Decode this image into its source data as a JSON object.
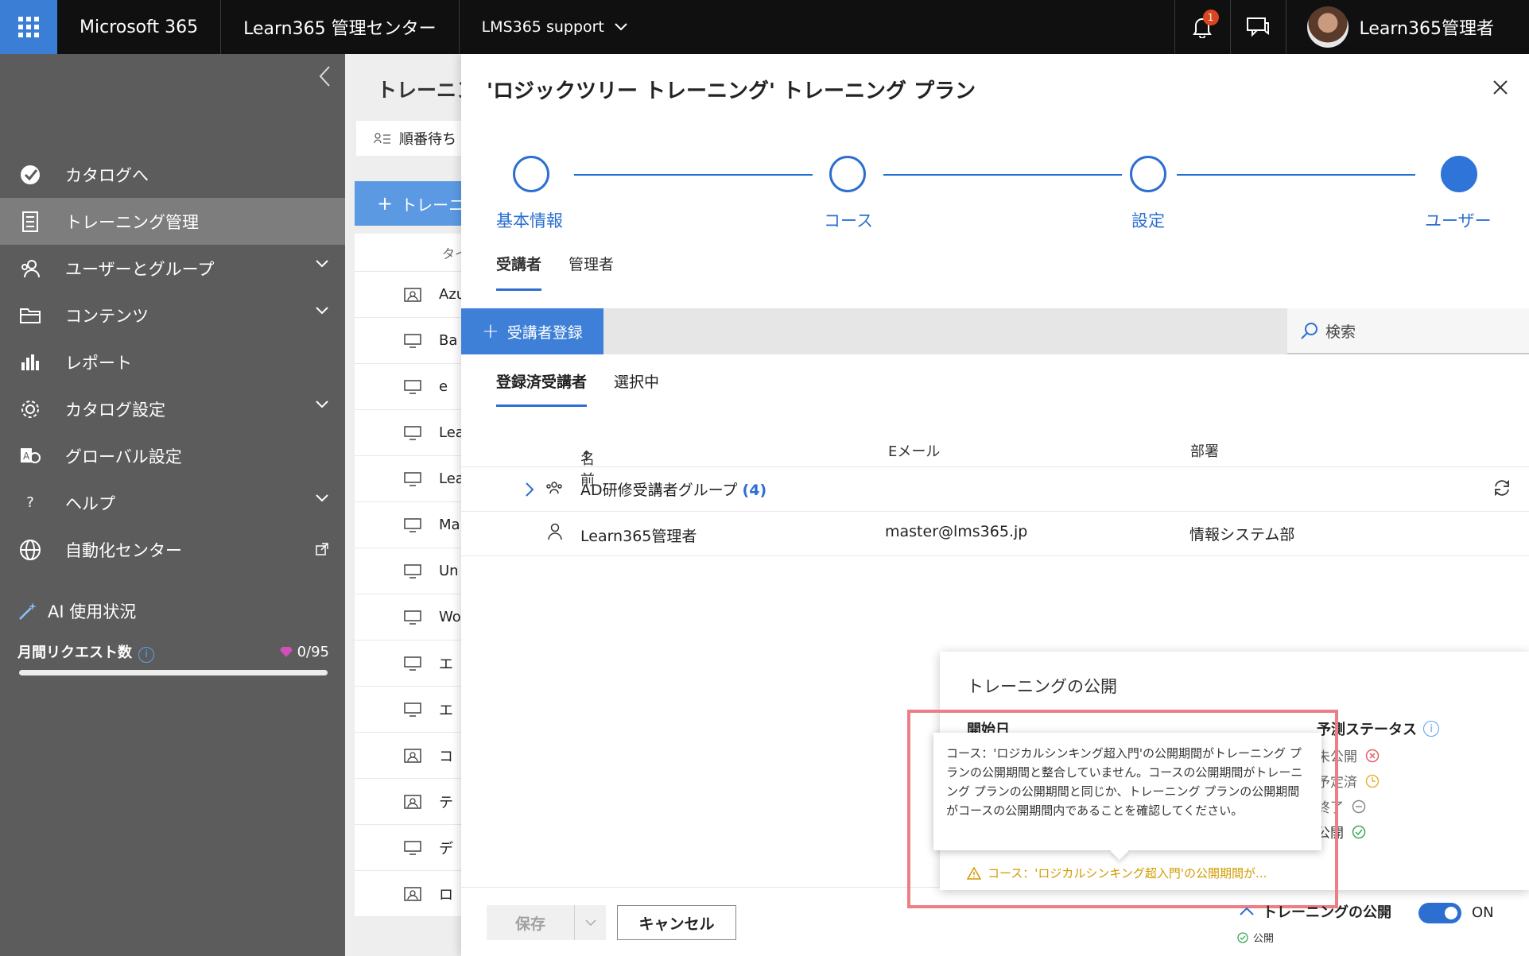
{
  "topbar": {
    "brand": "Microsoft 365",
    "app_title": "Learn365 管理センター",
    "tenant": "LMS365 support",
    "notification_count": "1",
    "user_name": "Learn365管理者"
  },
  "sidebar": {
    "items": [
      {
        "label": "カタログへ",
        "icon": "catalog-icon",
        "chevron": false
      },
      {
        "label": "トレーニング管理",
        "icon": "training-icon",
        "chevron": false,
        "active": true
      },
      {
        "label": "ユーザーとグループ",
        "icon": "users-icon",
        "chevron": true
      },
      {
        "label": "コンテンツ",
        "icon": "folder-icon",
        "chevron": true
      },
      {
        "label": "レポート",
        "icon": "report-icon",
        "chevron": false
      },
      {
        "label": "カタログ設定",
        "icon": "gear-icon",
        "chevron": true
      },
      {
        "label": "グローバル設定",
        "icon": "global-settings-icon",
        "chevron": false
      },
      {
        "label": "ヘルプ",
        "icon": "help-icon",
        "chevron": true
      },
      {
        "label": "自動化センター",
        "icon": "globe-icon",
        "chevron": false,
        "external": true
      }
    ],
    "ai": {
      "title": "AI 使用状況",
      "requests_label": "月間リクエスト数",
      "requests_value": "0/95"
    }
  },
  "background_page": {
    "title": "トレーニング",
    "queue_label": "順番待ち",
    "new_button": "トレーニ",
    "column_header": "タイ",
    "rows": [
      "Azu",
      "Ba",
      "e",
      "Lea",
      "Lea",
      "Ma",
      "Un",
      "Wo",
      "エ",
      "エ",
      "コ",
      "テ",
      "デ",
      "ロ"
    ]
  },
  "panel": {
    "title": "'ロジックツリー トレーニング' トレーニング プラン",
    "steps": [
      {
        "label": "基本情報"
      },
      {
        "label": "コース"
      },
      {
        "label": "設定"
      },
      {
        "label": "ユーザー"
      }
    ],
    "tabs": [
      {
        "label": "受講者",
        "active": true
      },
      {
        "label": "管理者",
        "active": false
      }
    ],
    "add_button": "受講者登録",
    "search_placeholder": "検索",
    "subtabs": [
      {
        "label": "登録済受講者",
        "active": true
      },
      {
        "label": "選択中",
        "active": false
      }
    ],
    "columns": {
      "name": "名前",
      "email": "Eメール",
      "dept": "部署"
    },
    "group_row": {
      "name": "AD研修受講者グループ",
      "count": "(4)"
    },
    "user_row": {
      "name": "Learn365管理者",
      "email": "master@lms365.jp",
      "dept": "情報システム部"
    },
    "footer": {
      "save": "保存",
      "cancel": "キャンセル"
    }
  },
  "publish_card": {
    "title": "トレーニングの公開",
    "start_label": "開始日",
    "status_label": "予測ステータス",
    "statuses": [
      "未公開",
      "予定済",
      "終了",
      "公開"
    ],
    "warning": "コース：'ロジカルシンキング超入門'の公開期間が...",
    "tooltip": "コース：'ロジカルシンキング超入門'の公開期間がトレーニング プランの公開期間と整合していません。コースの公開期間がトレーニング プランの公開期間と同じか、トレーニング プランの公開期間がコースの公開期間内であることを確認してください。"
  },
  "publish_bar": {
    "label": "トレーニングの公開",
    "sub": "公開",
    "toggle_state": "ON"
  },
  "colors": {
    "accent": "#2c6fd0",
    "topbar": "#101010",
    "sidebar": "#5c5c5c",
    "highlight": "#ec7f86",
    "warning": "#d29a00"
  }
}
